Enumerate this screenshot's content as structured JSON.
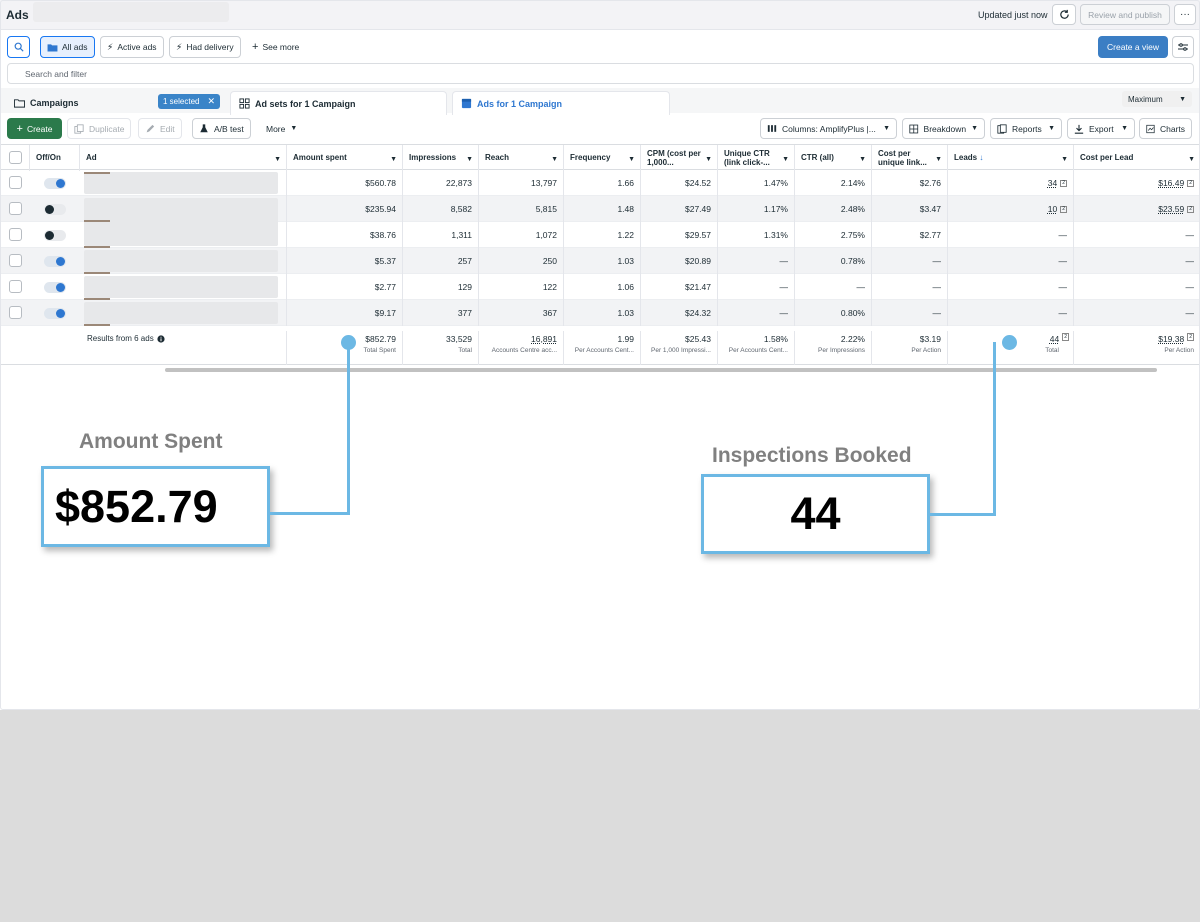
{
  "topbar": {
    "title": "Ads",
    "updated": "Updated just now",
    "review_publish": "Review and publish",
    "more": "···"
  },
  "filters": {
    "all_ads": "All ads",
    "active_ads": "Active ads",
    "had_delivery": "Had delivery",
    "see_more": "See more",
    "create_view": "Create a view",
    "search_placeholder": "Search and filter"
  },
  "tabs": {
    "campaigns": "Campaigns",
    "selected": "1 selected",
    "adsets": "Ad sets for 1 Campaign",
    "ads": "Ads for 1 Campaign",
    "maximum": "Maximum"
  },
  "toolbar": {
    "create": "Create",
    "duplicate": "Duplicate",
    "edit": "Edit",
    "ab_test": "A/B test",
    "more": "More",
    "columns": "Columns: AmplifyPlus |...",
    "breakdown": "Breakdown",
    "reports": "Reports",
    "export": "Export",
    "charts": "Charts"
  },
  "table": {
    "headers": {
      "offon": "Off/On",
      "ad": "Ad",
      "amount": "Amount spent",
      "impressions": "Impressions",
      "reach": "Reach",
      "frequency": "Frequency",
      "cpm": "CPM (cost per 1,000...",
      "uctr": "Unique CTR (link click-...",
      "ctr": "CTR (all)",
      "cpul": "Cost per unique link...",
      "leads": "Leads",
      "cpl": "Cost per Lead"
    },
    "rows": [
      {
        "on": true,
        "amount": "$560.78",
        "impressions": "22,873",
        "reach": "13,797",
        "frequency": "1.66",
        "cpm": "$24.52",
        "uctr": "1.47%",
        "ctr": "2.14%",
        "cpul": "$2.76",
        "leads": "34",
        "cpl": "$16.49"
      },
      {
        "on": false,
        "amount": "$235.94",
        "impressions": "8,582",
        "reach": "5,815",
        "frequency": "1.48",
        "cpm": "$27.49",
        "uctr": "1.17%",
        "ctr": "2.48%",
        "cpul": "$3.47",
        "leads": "10",
        "cpl": "$23.59"
      },
      {
        "on": false,
        "amount": "$38.76",
        "impressions": "1,311",
        "reach": "1,072",
        "frequency": "1.22",
        "cpm": "$29.57",
        "uctr": "1.31%",
        "ctr": "2.75%",
        "cpul": "$2.77",
        "leads": "—",
        "cpl": "—"
      },
      {
        "on": true,
        "amount": "$5.37",
        "impressions": "257",
        "reach": "250",
        "frequency": "1.03",
        "cpm": "$20.89",
        "uctr": "—",
        "ctr": "0.78%",
        "cpul": "—",
        "leads": "—",
        "cpl": "—"
      },
      {
        "on": true,
        "amount": "$2.77",
        "impressions": "129",
        "reach": "122",
        "frequency": "1.06",
        "cpm": "$21.47",
        "uctr": "—",
        "ctr": "—",
        "cpul": "—",
        "leads": "—",
        "cpl": "—"
      },
      {
        "on": true,
        "amount": "$9.17",
        "impressions": "377",
        "reach": "367",
        "frequency": "1.03",
        "cpm": "$24.32",
        "uctr": "—",
        "ctr": "0.80%",
        "cpul": "—",
        "leads": "—",
        "cpl": "—"
      }
    ],
    "summary": {
      "label": "Results from 6 ads",
      "amount": "$852.79",
      "amount_sub": "Total Spent",
      "impressions": "33,529",
      "impressions_sub": "Total",
      "reach": "16,891",
      "reach_sub": "Accounts Centre acc...",
      "frequency": "1.99",
      "frequency_sub": "Per Accounts Cent...",
      "cpm": "$25.43",
      "cpm_sub": "Per 1,000 Impressi...",
      "uctr": "1.58%",
      "uctr_sub": "Per Accounts Cent...",
      "ctr": "2.22%",
      "ctr_sub": "Per Impressions",
      "cpul": "$3.19",
      "cpul_sub": "Per Action",
      "leads": "44",
      "leads_sub": "Total",
      "cpl": "$19.38",
      "cpl_sub": "Per Action"
    }
  },
  "callouts": {
    "amount_label": "Amount Spent",
    "amount_value": "$852.79",
    "inspections_label": "Inspections Booked",
    "inspections_value": "44"
  },
  "colors": {
    "accent": "#6cb8e4",
    "primary_blue": "#2e77d0",
    "create_green": "#2b7a4b"
  }
}
